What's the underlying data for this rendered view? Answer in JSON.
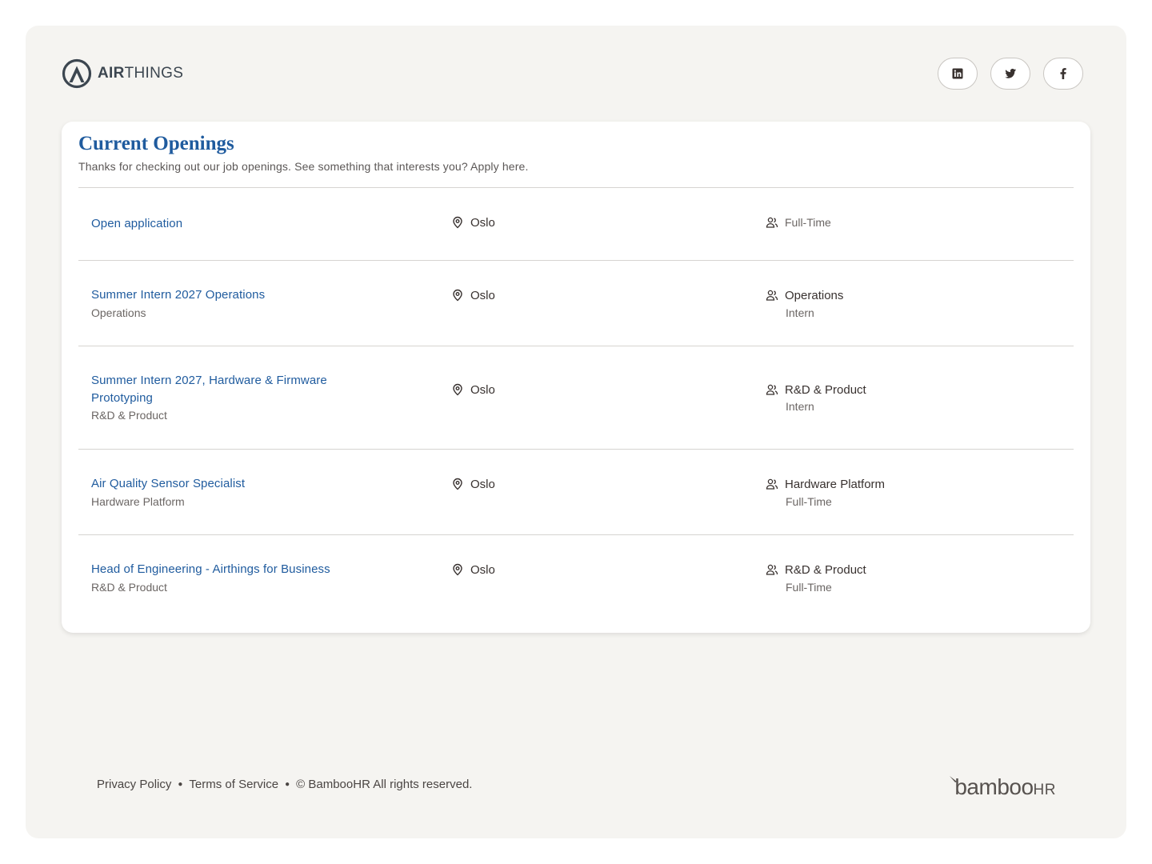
{
  "brand": {
    "name_strong": "AIR",
    "name_rest": "THINGS",
    "icon": "airthings-logo"
  },
  "socials": [
    {
      "name": "linkedin",
      "icon": "linkedin-icon"
    },
    {
      "name": "twitter",
      "icon": "twitter-icon"
    },
    {
      "name": "facebook",
      "icon": "facebook-icon"
    }
  ],
  "openings": {
    "title": "Current Openings",
    "subtitle": "Thanks for checking out our job openings. See something that interests you? Apply here.",
    "jobs": [
      {
        "title": "Open application",
        "department": "",
        "location": "Oslo",
        "team": "Full-Time",
        "type": ""
      },
      {
        "title": "Summer Intern 2027 Operations",
        "department": "Operations",
        "location": "Oslo",
        "team": "Operations",
        "type": "Intern"
      },
      {
        "title": "Summer Intern 2027, Hardware & Firmware Prototyping",
        "department": "R&D & Product",
        "location": "Oslo",
        "team": "R&D & Product",
        "type": "Intern"
      },
      {
        "title": "Air Quality Sensor Specialist",
        "department": "Hardware Platform",
        "location": "Oslo",
        "team": "Hardware Platform",
        "type": "Full-Time"
      },
      {
        "title": "Head of Engineering - Airthings for Business",
        "department": "R&D & Product",
        "location": "Oslo",
        "team": "R&D & Product",
        "type": "Full-Time"
      }
    ]
  },
  "footer": {
    "privacy": "Privacy Policy",
    "terms": "Terms of Service",
    "copyright": "© BambooHR All rights reserved.",
    "bamboo_main": "bamboo",
    "bamboo_hr": "HR"
  },
  "colors": {
    "accent": "#1f5b9e",
    "background": "#f5f4f1",
    "card": "#ffffff",
    "divider": "#d6d4d1"
  }
}
